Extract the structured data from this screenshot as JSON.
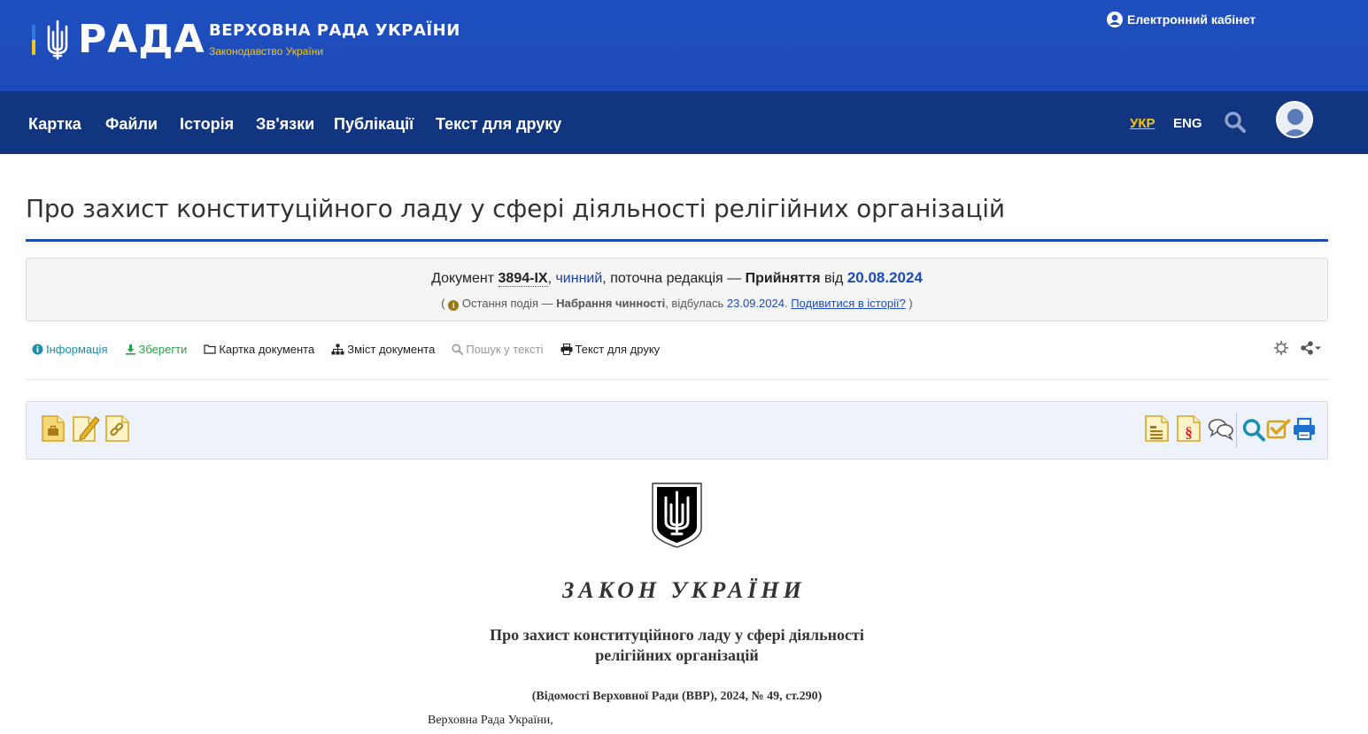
{
  "header": {
    "logo_word": "РАДА",
    "title": "ВЕРХОВНА РАДА УКРАЇНИ",
    "subtitle": "Законодавство України",
    "cabinet_label": "Електронний кабінет"
  },
  "nav": {
    "items": [
      "Картка",
      "Файли",
      "Історія",
      "Зв'язки",
      "Публікації",
      "Текст для друку"
    ],
    "lang_ukr": "УКР",
    "lang_eng": "ENG"
  },
  "page": {
    "title": "Про захист конституційного ладу у сфері діяльності релігійних організацій"
  },
  "status": {
    "doc_prefix": "Документ",
    "doc_number": "3894-IX",
    "comma": ",",
    "validity": "чинний",
    "edition_text": ", поточна редакція —",
    "stage": "Прийняття",
    "from": "від",
    "date": "20.08.2024",
    "open_paren": "(",
    "info_glyph": "i",
    "last_event_label": "Остання подія —",
    "last_event": "Набрання чинності",
    "happened": ", відбулась",
    "event_date": "23.09.2024",
    "dot": ".",
    "history_link": "Подивитися в історії?",
    "close_paren": ")"
  },
  "toolbar": {
    "info": "Інформація",
    "save": "Зберегти",
    "card": "Картка документа",
    "toc": "Зміст документа",
    "search": "Пошук у тексті",
    "print": "Текст для друку"
  },
  "document": {
    "heading": "ЗАКОН УКРАЇНИ",
    "title_line1": "Про захист конституційного ладу у сфері діяльності",
    "title_line2": "релігійних організацій",
    "source": "(Відомості Верховної Ради (ВВР), 2024, № 49, ст.290)",
    "first_line": "Верховна Рада України,"
  },
  "colors": {
    "header_blue": "#1f4fbf",
    "nav_dark_blue": "#12357f",
    "accent_yellow": "#f5c518",
    "link_blue": "#1d4bb8",
    "info_teal": "#1a8fb0",
    "save_green": "#2aa04a",
    "icon_gold": "#d9a521"
  },
  "icons": {
    "nav_search": "search-icon",
    "nav_avatar": "user-avatar-icon",
    "cabinet": "user-circle-icon",
    "toolbar_info": "info-circle-icon",
    "toolbar_save": "download-icon",
    "toolbar_card": "folder-icon",
    "toolbar_toc": "sitemap-icon",
    "toolbar_search": "search-icon",
    "toolbar_print": "print-icon",
    "toolbar_settings": "gear-icon",
    "toolbar_share": "share-icon",
    "panel_left": [
      "case-file-icon",
      "edit-document-icon",
      "link-document-icon"
    ],
    "panel_right": [
      "document-list-icon",
      "paragraph-document-icon",
      "comments-icon",
      "search-icon",
      "checkbox-icon",
      "print-icon"
    ]
  }
}
